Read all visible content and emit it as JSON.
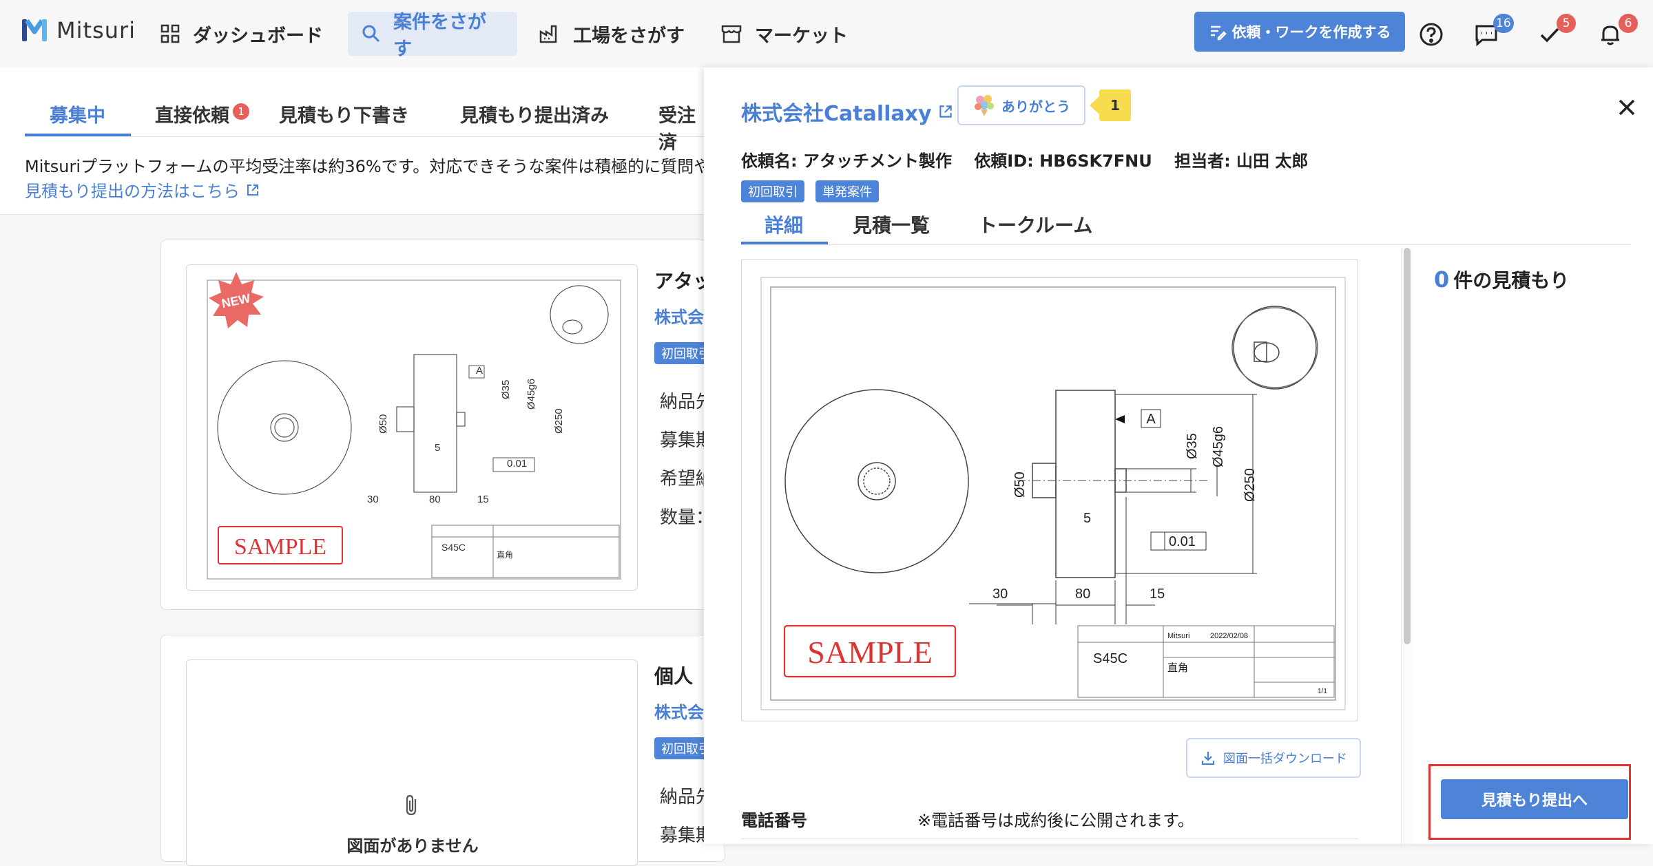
{
  "nav": {
    "logo_text": "Mitsuri",
    "items": [
      {
        "label": "ダッシュボード"
      },
      {
        "label": "案件をさがす"
      },
      {
        "label": "工場をさがす"
      },
      {
        "label": "マーケット"
      }
    ],
    "create_button": "依頼・ワークを作成する",
    "badges": {
      "messages": "16",
      "tasks": "5",
      "notifications": "6"
    },
    "colors": {
      "accent": "#4d84d8",
      "badge_blue": "#4d84d8",
      "badge_red": "#e5605a"
    }
  },
  "list": {
    "tabs": [
      {
        "label": "募集中"
      },
      {
        "label": "直接依頼",
        "badge": "1"
      },
      {
        "label": "見積もり下書き"
      },
      {
        "label": "見積もり提出済み"
      },
      {
        "label": "受注済"
      }
    ],
    "info_text": "Mitsuriプラットフォームの平均受注率は約36%です。対応できそうな案件は積極的に質問や",
    "info_link": "見積もり提出の方法はこちら",
    "cards": [
      {
        "title": "アタッ",
        "company": "株式会",
        "tag": "初回取引",
        "new_badge": "NEW",
        "fields": [
          "納品先",
          "募集期",
          "希望納",
          "数量："
        ]
      },
      {
        "title": "個人",
        "company": "株式会",
        "tag": "初回取引",
        "no_drawing": "図面がありません",
        "fields": [
          "納品先",
          "募集期"
        ]
      }
    ]
  },
  "drawing": {
    "sample_stamp": "SAMPLE",
    "dims": {
      "d1": "Ø35",
      "d2": "Ø45g6",
      "d3": "Ø250",
      "d4": "Ø50",
      "d5": "5",
      "d6": "30",
      "d7": "80",
      "d8": "15",
      "datum": "A",
      "tol": "0.01"
    },
    "title_block": {
      "material": "S45C",
      "created_by": "Mitsuri",
      "date": "2022/02/08",
      "title": "直角",
      "sheet": "1/1"
    }
  },
  "panel": {
    "company": "株式会社Catallaxy",
    "thanks_button": "ありがとう",
    "thanks_count": "1",
    "meta": {
      "request_name": "依頼名: アタッチメント製作",
      "request_id": "依頼ID: HB6SK7FNU",
      "assignee": "担当者: 山田 太郎"
    },
    "tags": [
      "初回取引",
      "単発案件"
    ],
    "tabs": [
      {
        "label": "詳細"
      },
      {
        "label": "見積一覧"
      },
      {
        "label": "トークルーム"
      }
    ],
    "download_button": "図面一括ダウンロード",
    "phone_label": "電話番号",
    "phone_value": "※電話番号は成約後に公開されます。",
    "quote_count_num": "0",
    "quote_count_text": "件の見積もり",
    "submit_button": "見積もり提出へ"
  }
}
